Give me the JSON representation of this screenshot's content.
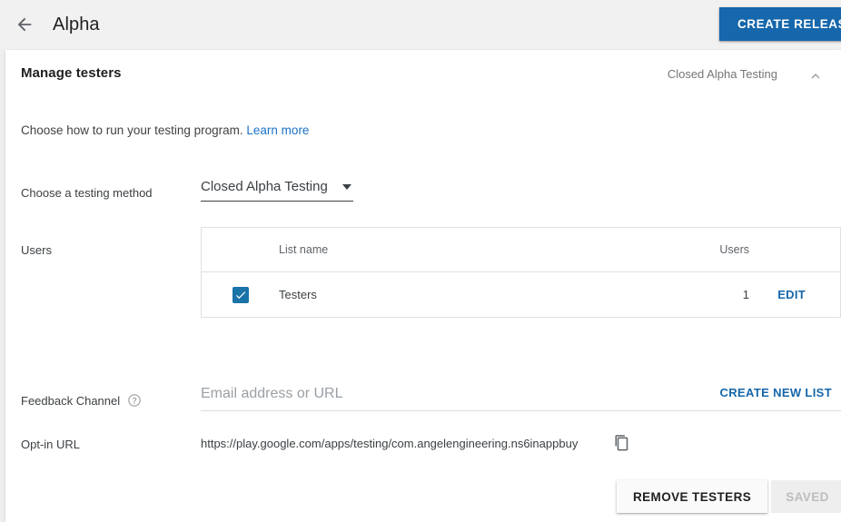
{
  "appbar": {
    "back_icon": "arrow-back-icon",
    "title": "Alpha",
    "create_release_label": "CREATE RELEASE",
    "accent_color": "#1667ab"
  },
  "card": {
    "title": "Manage testers",
    "status": "Closed Alpha Testing",
    "collapse_icon": "chevron-up-icon",
    "subtitle_text": "Choose how to run your testing program.",
    "learn_more_label": "Learn more"
  },
  "testing_method": {
    "label": "Choose a testing method",
    "selected": "Closed Alpha Testing",
    "caret_icon": "chevron-down-icon"
  },
  "users": {
    "label": "Users",
    "columns": [
      "List name",
      "Users"
    ],
    "rows": [
      {
        "checked": true,
        "list_name": "Testers",
        "users": "1",
        "action_label": "EDIT"
      }
    ],
    "create_new_list_label": "CREATE NEW LIST"
  },
  "feedback": {
    "label": "Feedback Channel",
    "help_icon": "help-circle-icon",
    "value": "",
    "placeholder": "Email address or URL"
  },
  "optin": {
    "label": "Opt-in URL",
    "url": "https://play.google.com/apps/testing/com.angelengineering.ns6inappbuy",
    "copy_icon": "copy-icon"
  },
  "footer": {
    "remove_label": "REMOVE TESTERS",
    "saved_label": "SAVED"
  }
}
